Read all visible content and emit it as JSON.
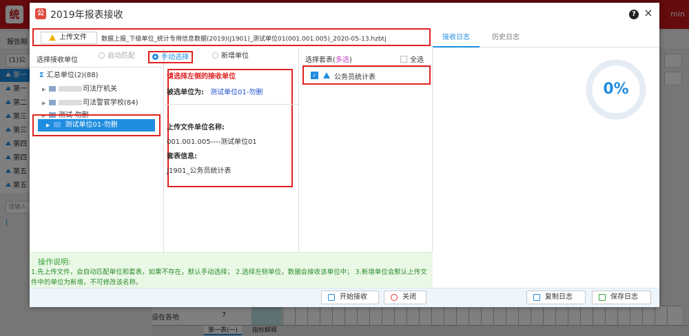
{
  "background": {
    "app_logo": "统",
    "user_name": "min",
    "report_period_label": "报告期",
    "combo_value": "(1)公",
    "sidebar_items": [
      "第一",
      "第一",
      "第二",
      "第三",
      "第三",
      "第四",
      "第四",
      "第五",
      "第五"
    ],
    "search_placeholder": "请输入",
    "tree_item": "(",
    "grid_row_label": "设在各地",
    "grid_row_number": "7",
    "sheet_tabs": [
      "第一表(一)",
      "指标解释"
    ]
  },
  "dialog": {
    "title": "2019年报表接收",
    "help_icon": "?",
    "close_icon": "×",
    "upload": {
      "button_label": "上传文件",
      "file_name": "数据上报_下级单位_统计专用信息数据(2019)(J1901)_测试单位01(001.001.005)_2020-05-13.hzbtj"
    },
    "tabs": [
      {
        "label": "接收日志",
        "active": true
      },
      {
        "label": "历史日志",
        "active": false
      }
    ],
    "unit_panel": {
      "heading": "选择接收单位",
      "radios": [
        {
          "label": "自动匹配",
          "checked": false,
          "disabled": true
        },
        {
          "label": "手动选择",
          "checked": true,
          "disabled": false
        },
        {
          "label": "新增单位",
          "checked": false,
          "disabled": false
        }
      ],
      "tree": [
        {
          "label": "汇总单位(2)(88)",
          "level": 0
        },
        {
          "label": "司法厅机关",
          "level": 1
        },
        {
          "label": "司法警官学校(84)",
          "level": 1
        },
        {
          "label": "测试-勿删",
          "level": 1
        }
      ],
      "selected": "测试单位01-勿删"
    },
    "info_panel": {
      "hint": "请选择左侧的接收单位",
      "selected_label": "被选单位为:",
      "selected_value": "测试单位01-勿删",
      "upload_unit_label": "上传文件单位名称:",
      "upload_unit_value": "001.001.005----测试单位01",
      "set_info_label": "套表信息:",
      "set_info_value": "J1901_公务员统计表"
    },
    "set_panel": {
      "heading": "选择套表(",
      "heading_multi": "多选",
      "heading_end": ")",
      "select_all": "全选",
      "items": [
        {
          "label": "公务员统计表",
          "checked": true
        }
      ]
    },
    "progress": {
      "value": 0,
      "label": "0%"
    },
    "notes": {
      "title": "操作说明:",
      "body": "1.先上传文件，会自动匹配单位和套表，如果不存在，默认手动选择； 2.选择左侧单位，数据会接收该单位中； 3.新增单位会默认上传文件中的单位为新增，不可修改该名称。"
    },
    "buttons": {
      "start": "开始接收",
      "close": "关闭",
      "copy_log": "复制日志",
      "save_log": "保存日志"
    }
  },
  "colors": {
    "accent": "#1f8de0",
    "highlight": "#e02020",
    "brand": "#c8161d",
    "note_text": "#2c8c2c"
  }
}
